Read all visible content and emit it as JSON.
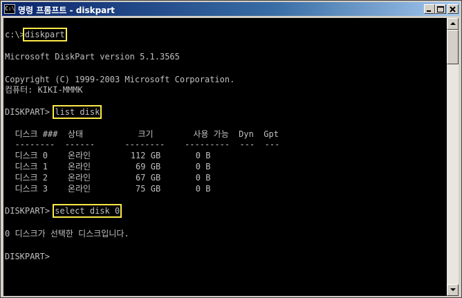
{
  "window": {
    "title": "명령 프롬프트 - diskpart",
    "icon": "console-icon",
    "icon_text": "C:\\"
  },
  "console": {
    "prompt1": "c:\\>",
    "cmd1": "diskpart",
    "version": "Microsoft DiskPart version 5.1.3565",
    "copyright": "Copyright (C) 1999-2003 Microsoft Corporation.",
    "computer": "컴퓨터: KIKI-MMMK",
    "prompt2": "DISKPART>",
    "cmd2": "list disk",
    "table": {
      "header": "  디스크 ###  상태           크기        사용 가능  Dyn  Gpt",
      "rule": "  --------  ------      --------    ---------  ---  ---",
      "rows": [
        "  디스크 0    온라인        112 GB       0 B",
        "  디스크 1    온라인         69 GB       0 B",
        "  디스크 2    온라인         67 GB       0 B",
        "  디스크 3    온라인         75 GB       0 B"
      ]
    },
    "prompt3": "DISKPART>",
    "cmd3": "select disk 0",
    "result": "0 디스크가 선택한 디스크입니다.",
    "prompt4": "DISKPART>"
  },
  "colors": {
    "highlight": "#ffea4a",
    "console_bg": "#000000",
    "console_fg": "#c0c0c0",
    "titlebar": "#0a246a"
  }
}
